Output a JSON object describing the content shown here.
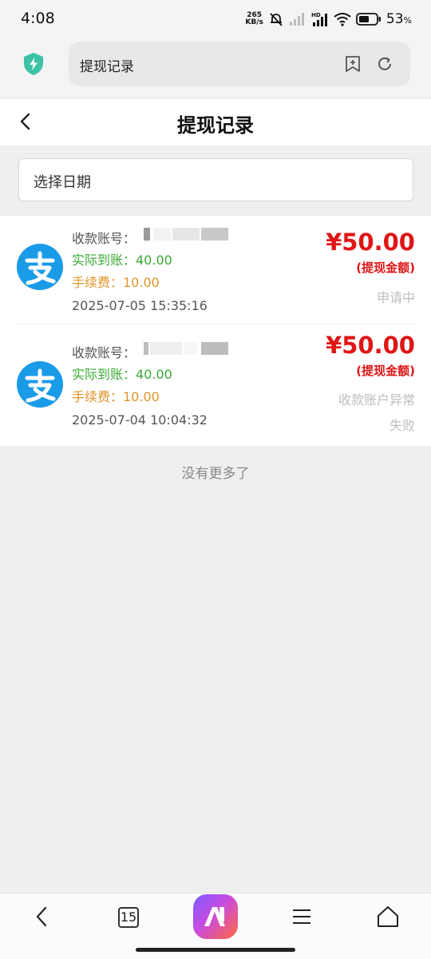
{
  "status_bar": {
    "time": "4:08",
    "net_speed_value": "265",
    "net_speed_unit": "KB/s",
    "battery_percent": "53",
    "battery_suffix": "%"
  },
  "browser": {
    "url_text": "提现记录"
  },
  "header": {
    "title": "提现记录"
  },
  "filter": {
    "date_label": "选择日期"
  },
  "records": [
    {
      "account_label": "收款账号：",
      "received": "实际到账：40.00",
      "fee": "手续费：10.00",
      "time": "2025-07-05 15:35:16",
      "amount": "¥50.00",
      "amount_label": "(提现金额)",
      "status": "申请中",
      "status_detail": ""
    },
    {
      "account_label": "收款账号：",
      "received": "实际到账：40.00",
      "fee": "手续费：10.00",
      "time": "2025-07-04 10:04:32",
      "amount": "¥50.00",
      "amount_label": "(提现金额)",
      "status": "收款账户异常",
      "status_detail": "失败"
    }
  ],
  "footer": {
    "no_more": "没有更多了"
  },
  "bottom_nav": {
    "tab_count": "15"
  },
  "colors": {
    "amount_red": "#e01515",
    "received_green": "#3aaa35",
    "fee_orange": "#e0952a",
    "alipay_blue": "#1a9be8"
  },
  "icons": [
    "shield-icon",
    "add-bookmark-icon",
    "refresh-icon",
    "back-arrow-icon",
    "alipay-icon",
    "nav-back-icon",
    "tabs-icon",
    "app-logo-icon",
    "menu-icon",
    "home-icon"
  ]
}
